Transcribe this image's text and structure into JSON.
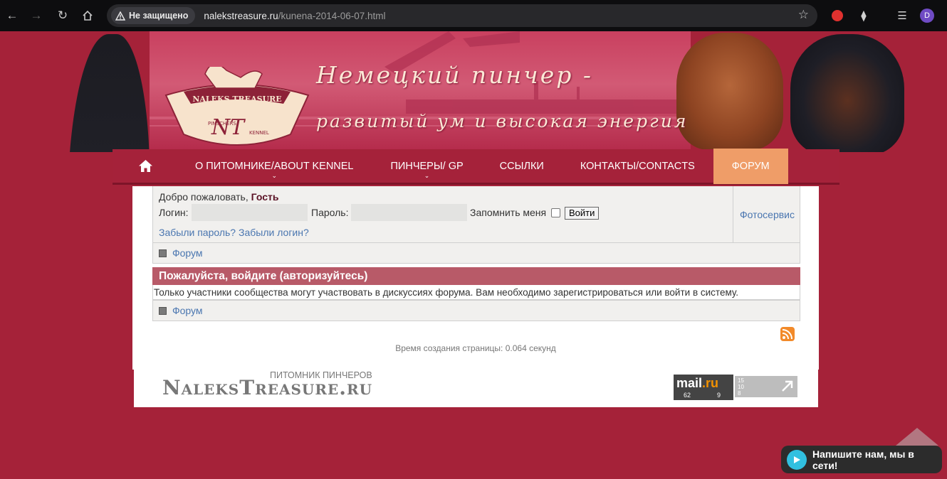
{
  "browser": {
    "security_label": "Не защищено",
    "url_host": "nalekstreasure.ru",
    "url_path": "/kunena-2014-06-07.html",
    "profile_initial": "D"
  },
  "header": {
    "logo_text": "NALEKS TREASURE",
    "logo_sub_left": "PINSCHERS",
    "logo_sub_right": "KENNEL",
    "logo_mark": "NT",
    "slogan_line1": "Немецкий пинчер -",
    "slogan_line2": "развитый ум и высокая энергия"
  },
  "nav": {
    "items": [
      {
        "label": "О ПИТОМНИКЕ/ABOUT KENNEL"
      },
      {
        "label": "ПИНЧЕРЫ/ GP"
      },
      {
        "label": "ССЫЛКИ"
      },
      {
        "label": "КОНТАКТЫ/CONTACTS"
      },
      {
        "label": "ФОРУМ"
      }
    ]
  },
  "login": {
    "welcome_prefix": "Добро пожаловать,",
    "welcome_user": "Гость",
    "username_label": "Логин:",
    "password_label": "Пароль:",
    "remember_label": "Запомнить меня",
    "login_button": "Войти",
    "forgot_password": "Забыли пароль?",
    "forgot_login": "Забыли логин?",
    "photo_service": "Фотосервис"
  },
  "breadcrumb": {
    "label": "Форум"
  },
  "message": {
    "title": "Пожалуйста, войдите (авторизуйтесь)",
    "body": "Только участники сообщества могут участвовать в дискуссиях форума. Вам необходимо зарегистрироваться или войти в систему."
  },
  "breadcrumb_bottom": {
    "label": "Форум"
  },
  "page_time": "Время создания страницы: 0.064 секунд",
  "footer": {
    "subtitle": "ПИТОМНИК ПИНЧЕРОВ",
    "logo": "NaleksTreasure.ru",
    "mailru_brand": "mail",
    "mailru_tld": ".ru",
    "mailru_n1": "62",
    "mailru_n2": "9",
    "counter_a": "15",
    "counter_b": "10",
    "counter_c": "8"
  },
  "chat": {
    "label": "Напишите нам, мы в сети!"
  },
  "colors": {
    "page_bg": "#a52239",
    "accent_forum": "#ef9d68",
    "message_header": "#b85a68",
    "link": "#4a76b0"
  }
}
